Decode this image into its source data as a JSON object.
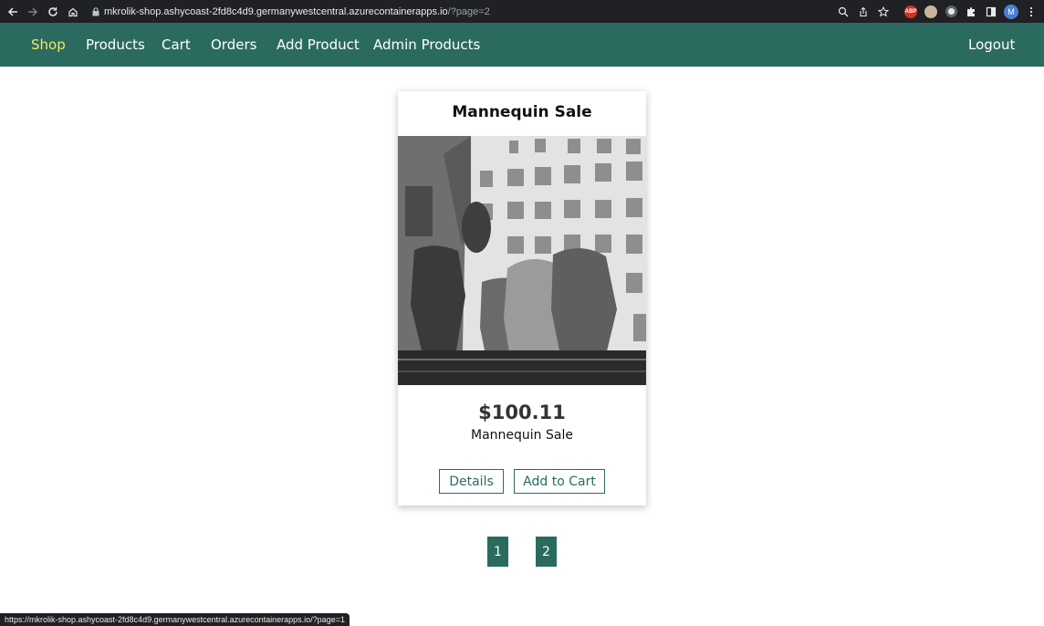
{
  "browser": {
    "url_host": "mkrolik-shop.ashycoast-2fd8c4d9.germanywestcentral.azurecontainerapps.io",
    "url_path": "/?page=2",
    "status_url": "https://mkrolik-shop.ashycoast-2fd8c4d9.germanywestcentral.azurecontainerapps.io/?page=1",
    "profile_initial": "M",
    "abp_label": "ABP"
  },
  "nav": {
    "shop": "Shop",
    "products": "Products",
    "cart": "Cart",
    "orders": "Orders",
    "add_product": "Add Product",
    "admin_products": "Admin Products",
    "logout": "Logout",
    "active_color": "#f5e663",
    "bg_color": "#2b6b5f"
  },
  "product": {
    "title": "Mannequin Sale",
    "price": "$100.11",
    "description": "Mannequin Sale",
    "details_label": "Details",
    "add_to_cart_label": "Add to Cart"
  },
  "pagination": {
    "pages": [
      "1",
      "2"
    ]
  }
}
